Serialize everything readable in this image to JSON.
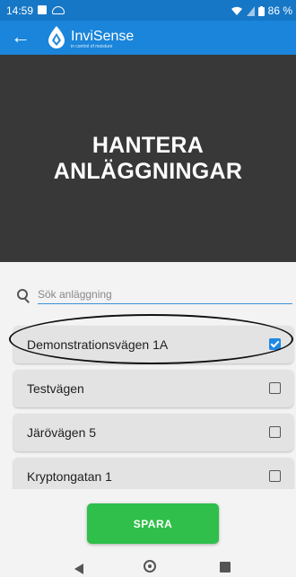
{
  "status_bar": {
    "time": "14:59",
    "left_icons": [
      "photo-icon",
      "cloud-icon"
    ],
    "right_text": "86 %",
    "right_icons": [
      "wifi-icon",
      "signal-icon",
      "battery-icon"
    ]
  },
  "app_bar": {
    "back_icon": "arrow-left-icon",
    "logo_text": "InviSense",
    "logo_tagline": "in control of moisture"
  },
  "hero": {
    "title": "HANTERA\nANLÄGGNINGAR"
  },
  "search": {
    "placeholder": "Sök anläggning",
    "value": "",
    "icon": "search-icon"
  },
  "facilities": [
    {
      "label": "Demonstrationsvägen 1A",
      "checked": true
    },
    {
      "label": "Testvägen",
      "checked": false
    },
    {
      "label": "Järövägen 5",
      "checked": false
    },
    {
      "label": "Kryptongatan 1",
      "checked": false
    }
  ],
  "save_button": {
    "label": "SPARA"
  },
  "colors": {
    "status_bar": "#1677c6",
    "app_bar": "#1a85da",
    "hero_bg": "#383838",
    "accent_blue": "#1e88e5",
    "save_green": "#2fbf4a"
  },
  "nav_bar": {
    "icons": [
      "nav-back-icon",
      "nav-home-icon",
      "nav-recents-icon"
    ]
  }
}
